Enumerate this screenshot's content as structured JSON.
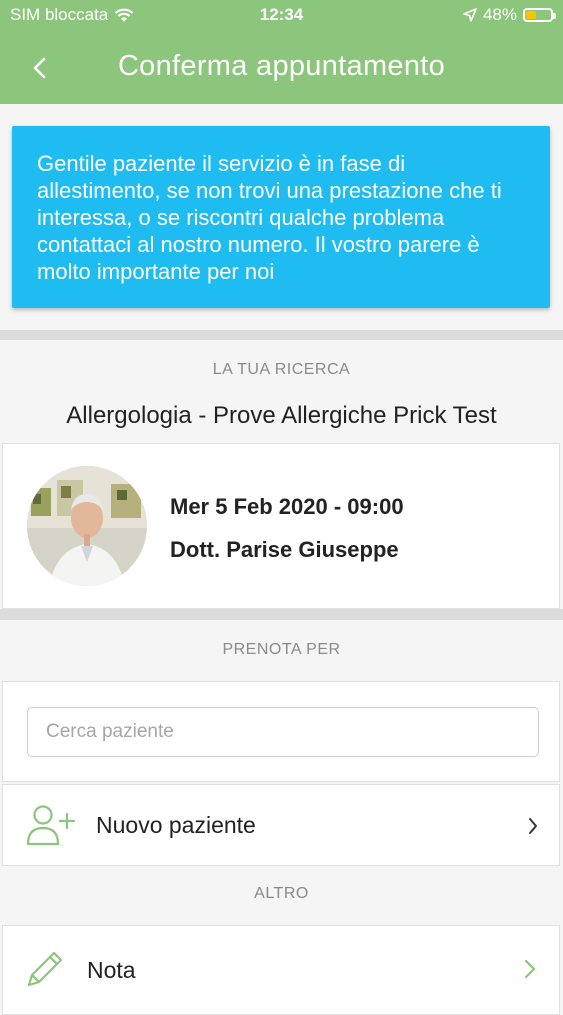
{
  "status_bar": {
    "carrier": "SIM bloccata",
    "time": "12:34",
    "battery": "48%",
    "battery_level": 0.48,
    "battery_color": "#f7c600"
  },
  "nav": {
    "title": "Conferma appuntamento",
    "back_icon": "chevron-left-icon",
    "color": "#8cc57c"
  },
  "banner": {
    "text": "Gentile paziente il servizio è in fase di allestimento, se non trovi una prestazione che ti interessa, o se riscontri qualche problema contattaci al nostro numero. Il vostro parere è molto importante per noi",
    "color": "#1ebcf0"
  },
  "search_section": {
    "label": "LA TUA RICERCA",
    "title": "Allergologia - Prove Allergiche Prick Test"
  },
  "appointment": {
    "datetime": "Mer 5 Feb 2020 - 09:00",
    "doctor": "Dott. Parise Giuseppe"
  },
  "book_for": {
    "label": "PRENOTA PER",
    "search_placeholder": "Cerca paziente",
    "search_value": "",
    "new_patient_label": "Nuovo paziente",
    "new_patient_icon": "add-user-icon"
  },
  "other": {
    "label": "ALTRO",
    "note_label": "Nota",
    "note_icon": "pencil-icon"
  }
}
